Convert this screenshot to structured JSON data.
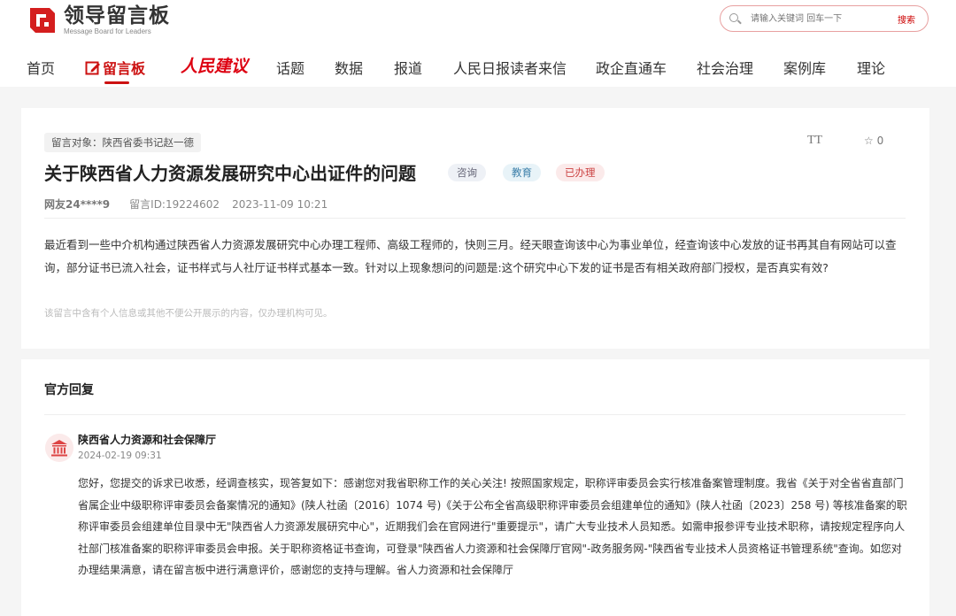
{
  "header": {
    "logo_cn": "领导留言板",
    "logo_en": "Message Board for Leaders",
    "search_placeholder": "请输入关键词 回车一下",
    "search_button": "搜索"
  },
  "nav": {
    "items": [
      "首页",
      "留言板",
      "人民建议",
      "话题",
      "数据",
      "报道",
      "人民日报读者来信",
      "政企直通车",
      "社会治理",
      "案例库",
      "理论"
    ],
    "active": "留言板"
  },
  "message": {
    "target": "留言对象：陕西省委书记赵一德",
    "title": "关于陕西省人力资源发展研究中心出证件的问题",
    "tags": [
      "咨询",
      "教育",
      "已办理"
    ],
    "user": "网友24****9",
    "message_id": "留言ID:19224602",
    "time": "2023-11-09 10:21",
    "star_count": "0",
    "font_icon": "TT",
    "body": "最近看到一些中介机构通过陕西省人力资源发展研究中心办理工程师、高级工程师的，快则三月。经天眼查询该中心为事业单位，经查询该中心发放的证书再其自有网站可以查询，部分证书已流入社会，证书样式与人社厅证书样式基本一致。针对以上现象想问的问题是:这个研究中心下发的证书是否有相关政府部门授权，是否真实有效?",
    "privacy_note": "该留言中含有个人信息或其他不便公开展示的内容，仅办理机构可见。"
  },
  "reply": {
    "section_title": "官方回复",
    "department": "陕西省人力资源和社会保障厅",
    "time": "2024-02-19 09:31",
    "body": "您好，您提交的诉求已收悉，经调查核实，现答复如下：感谢您对我省职称工作的关心关注! 按照国家规定，职称评审委员会实行核准备案管理制度。我省《关于对全省省直部门省属企业中级职称评审委员会备案情况的通知》(陕人社函〔2016〕1074 号)《关于公布全省高级职称评审委员会组建单位的通知》(陕人社函〔2023〕258 号) 等核准备案的职称评审委员会组建单位目录中无\"陕西省人力资源发展研究中心\"，近期我们会在官网进行\"重要提示\"，请广大专业技术人员知悉。如需申报参评专业技术职称，请按规定程序向人社部门核准备案的职称评审委员会申报。关于职称资格证书查询，可登录\"陕西省人力资源和社会保障厅官网\"-政务服务网-\"陕西省专业技术人员资格证书管理系统\"查询。如您对办理结果满意，请在留言板中进行满意评价，感谢您的支持与理解。省人力资源和社会保障厅"
  },
  "colors": {
    "brand": "#cc1111",
    "tag_done": "#cc4444"
  }
}
